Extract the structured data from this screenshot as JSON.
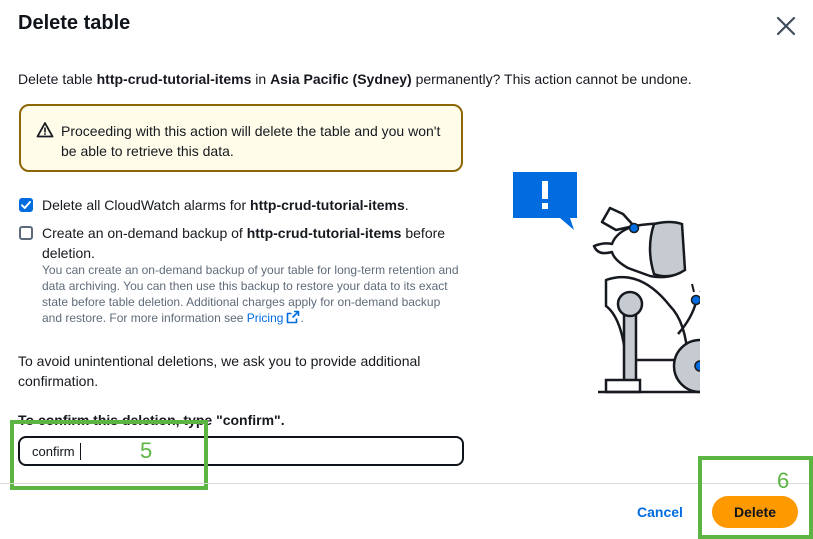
{
  "dialog": {
    "title": "Delete table",
    "description": {
      "prefix": "Delete table ",
      "table_name": "http-crud-tutorial-items",
      "middle": " in ",
      "region": "Asia Pacific (Sydney)",
      "suffix": " permanently? This action cannot be undone."
    },
    "alert": "Proceeding with this action will delete the table and you won't be able to retrieve this data.",
    "options": [
      {
        "label_prefix": "Delete all CloudWatch alarms for ",
        "label_bold": "http-crud-tutorial-items",
        "label_suffix": ".",
        "checked": true
      },
      {
        "label_prefix": "Create an on-demand backup of ",
        "label_bold": "http-crud-tutorial-items",
        "label_suffix": " before deletion.",
        "checked": false
      }
    ],
    "backup_hint": "You can create an on-demand backup of your table for long-term retention and data archiving. You can then use this backup to restore your data to its exact state before table deletion. Additional charges apply for on-demand backup and restore. For more information see ",
    "pricing_link": "Pricing",
    "hint_end": ".",
    "confirm_info": "To avoid unintentional deletions, we ask you to provide additional confirmation.",
    "confirm_prompt": "To confirm this deletion, type \"confirm\".",
    "confirm_value": "confirm",
    "cancel_label": "Cancel",
    "delete_label": "Delete"
  },
  "annotations": [
    {
      "label": "5"
    },
    {
      "label": "6"
    }
  ],
  "colors": {
    "accent": "#006ce0",
    "primary_button": "#ff9900",
    "warning_border": "#8d6605",
    "warning_bg": "#fffce9",
    "annotation": "#5cb543"
  }
}
